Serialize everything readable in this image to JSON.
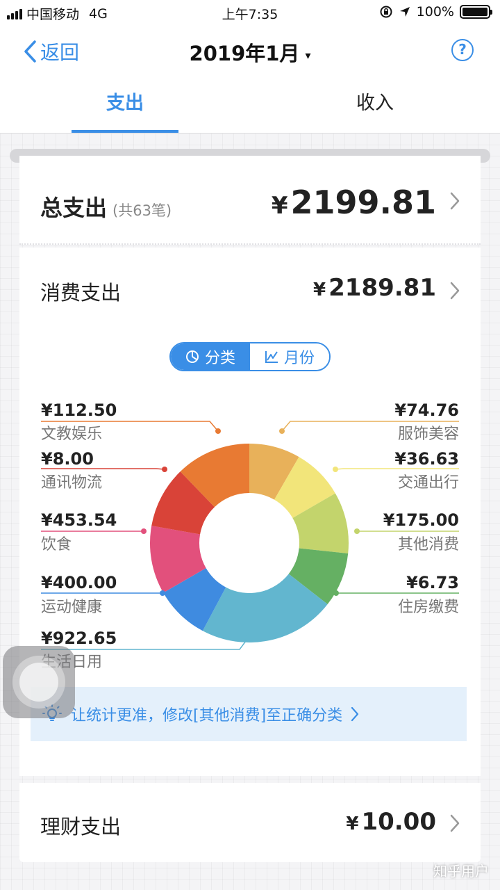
{
  "status_bar": {
    "carrier": "中国移动",
    "network": "4G",
    "time": "上午7:35",
    "battery": "100%"
  },
  "nav": {
    "back_label": "返回",
    "title": "2019年1月",
    "caret": "▾",
    "help": "?"
  },
  "tabs": [
    {
      "label": "支出",
      "active": true
    },
    {
      "label": "收入",
      "active": false
    }
  ],
  "summary": {
    "title": "总支出",
    "count": "(共63笔)",
    "currency": "¥",
    "amount": "2199.81"
  },
  "consumption": {
    "title": "消费支出",
    "currency": "¥",
    "amount": "2189.81"
  },
  "segmented": {
    "category_label": "分类",
    "month_label": "月份"
  },
  "chart_data": {
    "type": "pie",
    "donut": true,
    "currency": "¥",
    "categories": [
      {
        "name": "服饰美容",
        "label": "¥74.76",
        "value": 74.76,
        "color": "#e8b15a"
      },
      {
        "name": "交通出行",
        "label": "¥36.63",
        "value": 36.63,
        "color": "#f2e57a"
      },
      {
        "name": "其他消费",
        "label": "¥175.00",
        "value": 175.0,
        "color": "#c3d46c"
      },
      {
        "name": "住房缴费",
        "label": "¥6.73",
        "value": 6.73,
        "color": "#65b063"
      },
      {
        "name": "生活日用",
        "label": "¥922.65",
        "value": 922.65,
        "color": "#62b6cf"
      },
      {
        "name": "运动健康",
        "label": "¥400.00",
        "value": 400.0,
        "color": "#3f8be0"
      },
      {
        "name": "饮食",
        "label": "¥453.54",
        "value": 453.54,
        "color": "#e2507c"
      },
      {
        "name": "通讯物流",
        "label": "¥8.00",
        "value": 8.0,
        "color": "#d94338"
      },
      {
        "name": "文教娱乐",
        "label": "¥112.50",
        "value": 112.5,
        "color": "#e87a33"
      }
    ]
  },
  "tip": {
    "text": "让统计更准，修改[其他消费]至正确分类"
  },
  "finance": {
    "title": "理财支出",
    "currency": "¥",
    "amount": "10.00"
  },
  "watermark": "知乎用户",
  "colors": {
    "accent": "#3a8ee6",
    "tip_bg": "#e4f0fb"
  },
  "icons": [
    "back-chevron-icon",
    "help-icon",
    "pie-icon",
    "line-chart-icon",
    "lightbulb-icon",
    "chevron-right-icon"
  ]
}
